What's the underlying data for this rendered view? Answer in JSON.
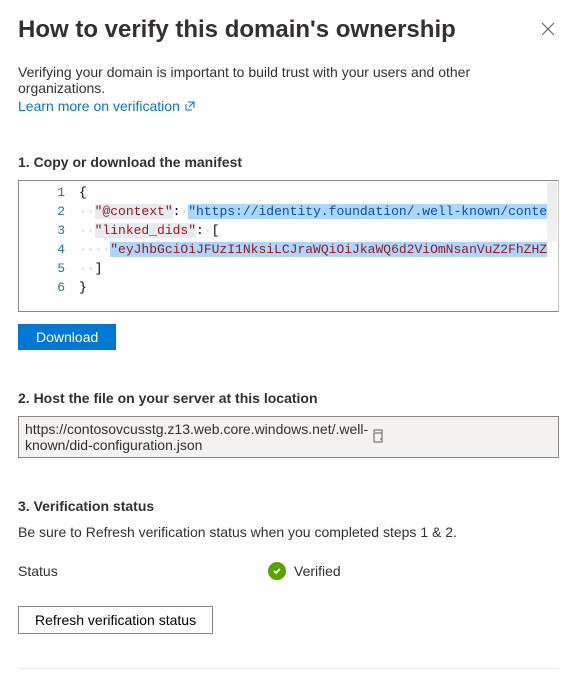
{
  "header": {
    "title": "How to verify this domain's ownership"
  },
  "intro": {
    "text": "Verifying your domain is important to build trust with your users and other organizations.",
    "link": "Learn more on verification"
  },
  "step1": {
    "heading": "1. Copy or download the manifest",
    "download_label": "Download",
    "code": {
      "l1_open": "{",
      "l2_key": "\"@context\"",
      "l2_val_prefix": "\"https://identity.foundation/.well-known/conte",
      "l3_key": "\"linked_dids\"",
      "l3_bracket": "[",
      "l4_val": "\"eyJhbGciOiJFUzI1NksiLCJraWQiOiJkaWQ6d2ViOmNsanVuZ2FhZHZ",
      "l5_close_arr": "]",
      "l6_close": "}"
    }
  },
  "step2": {
    "heading": "2. Host the file on your server at this location",
    "url": "https://contosovcusstg.z13.web.core.windows.net/.well-known/did-configuration.json"
  },
  "step3": {
    "heading": "3. Verification status",
    "hint": "Be sure to Refresh verification status when you completed steps 1 & 2.",
    "status_label": "Status",
    "status_value": "Verified",
    "refresh_label": "Refresh verification status"
  }
}
